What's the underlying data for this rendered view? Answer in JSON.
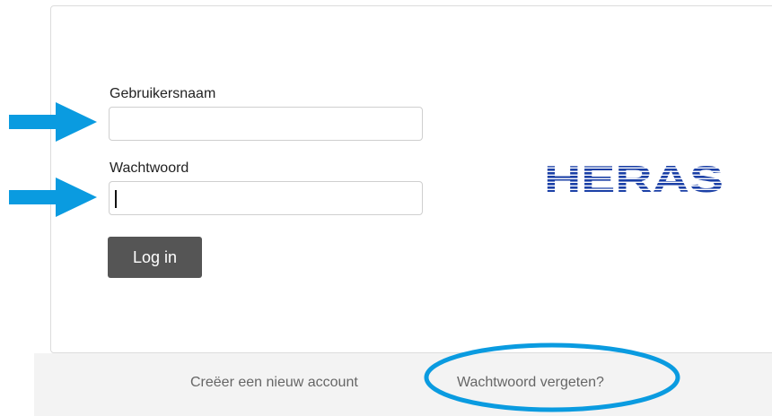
{
  "form": {
    "username_label": "Gebruikersnaam",
    "username_value": "",
    "password_label": "Wachtwoord",
    "password_value": "",
    "login_label": "Log in"
  },
  "logo": {
    "text": "HERAS",
    "color": "#1a3fa6"
  },
  "footer": {
    "create_account_label": "Creëer een nieuw account",
    "forgot_password_label": "Wachtwoord vergeten?"
  },
  "annotations": {
    "arrow_color": "#0a9be0",
    "ellipse_color": "#0a9be0"
  }
}
